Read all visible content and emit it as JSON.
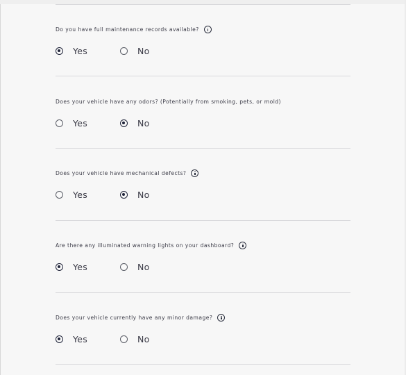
{
  "questions": [
    {
      "text": "Do you have full maintenance records available?",
      "has_info_icon": true,
      "yes_label": "Yes",
      "no_label": "No",
      "selected": "Yes"
    },
    {
      "text": "Does your vehicle have any odors? (Potentially from smoking, pets, or mold)",
      "has_info_icon": false,
      "yes_label": "Yes",
      "no_label": "No",
      "selected": "No"
    },
    {
      "text": "Does your vehicle have mechanical defects?",
      "has_info_icon": true,
      "yes_label": "Yes",
      "no_label": "No",
      "selected": "No"
    },
    {
      "text": "Are there any illuminated warning lights on your dashboard?",
      "has_info_icon": true,
      "yes_label": "Yes",
      "no_label": "No",
      "selected": "Yes"
    },
    {
      "text": "Does your vehicle currently have any minor damage?",
      "has_info_icon": true,
      "yes_label": "Yes",
      "no_label": "No",
      "selected": "Yes"
    }
  ],
  "colors": {
    "background": "#f7f7f7",
    "divider": "#d9d9dc",
    "radio_selected": "#20243a",
    "text": "#3a3a46"
  }
}
